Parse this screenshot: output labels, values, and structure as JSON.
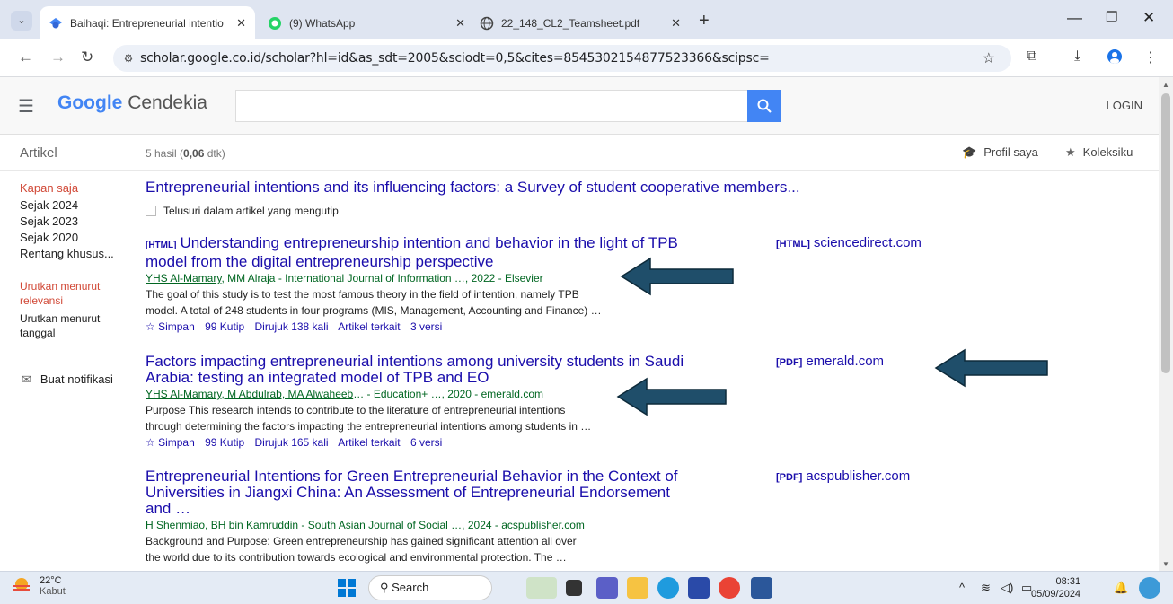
{
  "browser": {
    "tabs": [
      {
        "title": "Baihaqi: Entrepreneurial intentio",
        "close": "✕"
      },
      {
        "title": "(9) WhatsApp",
        "close": "✕"
      },
      {
        "title": "22_148_CL2_Teamsheet.pdf",
        "close": "✕"
      }
    ],
    "url": "scholar.google.co.id/scholar?hl=id&as_sdt=2005&sciodt=0,5&cites=8545302154877523366&scipsc="
  },
  "header": {
    "logo_google": "Google",
    "logo_cendekia": "Cendekia",
    "login": "LOGIN"
  },
  "subbar": {
    "section": "Artikel",
    "count_prefix": "5 hasil (",
    "count_time": "0,06",
    "count_suffix": " dtk)",
    "profile": "Profil saya",
    "collection": "Koleksiku"
  },
  "filters": {
    "time": [
      "Kapan saja",
      "Sejak 2024",
      "Sejak 2023",
      "Sejak 2020",
      "Rentang khusus..."
    ],
    "sort": [
      "Urutkan menurut relevansi",
      "Urutkan menurut tanggal"
    ],
    "alert": "Buat notifikasi"
  },
  "cited_work": {
    "title": "Entrepreneurial intentions and its influencing factors: a Survey of student cooperative members...",
    "search_within": "Telusuri dalam artikel yang mengutip"
  },
  "results": [
    {
      "tag": "[HTML]",
      "title_l1": "Understanding entrepreneurship intention and behavior in the light of TPB",
      "title_l2": "model from the digital entrepreneurship perspective",
      "authors_linked": "YHS Al-Mamary",
      "authors_rest": ", MM Alraja - International Journal of Information …, 2022 - Elsevier",
      "snippet_l1": "The goal of this study is to test the most famous theory in the field of intention, namely TPB",
      "snippet_l2": "model. A total of 248 students in four programs (MIS, Management, Accounting and Finance) …",
      "save": "☆ Simpan",
      "cite": "99 Kutip",
      "cited_by": "Dirujuk 138 kali",
      "related": "Artikel terkait",
      "versions": "3 versi",
      "side_tag": "[HTML]",
      "side_domain": "sciencedirect.com"
    },
    {
      "tag": "",
      "title_l1": "Factors impacting entrepreneurial intentions among university students in Saudi",
      "title_l2": "Arabia: testing an integrated model of TPB and EO",
      "authors_linked": "YHS Al-Mamary, M Abdulrab, MA Alwaheeb",
      "authors_rest": "… - Education+ …, 2020 - emerald.com",
      "snippet_l1": "Purpose This research intends to contribute to the literature of entrepreneurial intentions",
      "snippet_l2": "through determining the factors impacting the entrepreneurial intentions among students in …",
      "save": "☆ Simpan",
      "cite": "99 Kutip",
      "cited_by": "Dirujuk 165 kali",
      "related": "Artikel terkait",
      "versions": "6 versi",
      "side_tag": "[PDF]",
      "side_domain": "emerald.com"
    },
    {
      "tag": "",
      "title_l1": "Entrepreneurial Intentions for Green Entrepreneurial Behavior in the Context of",
      "title_l2": "Universities in Jiangxi China: An Assessment of Entrepreneurial Endorsement",
      "title_l3": "and …",
      "authors_rest": "H Shenmiao, BH bin Kamruddin - South Asian Journal of Social …, 2024 - acspublisher.com",
      "snippet_l1": "Background and Purpose: Green entrepreneurship has gained significant attention all over",
      "snippet_l2": "the world due to its contribution towards ecological and environmental protection. The …",
      "side_tag": "[PDF]",
      "side_domain": "acspublisher.com"
    }
  ],
  "taskbar": {
    "temp": "22°C",
    "weather": "Kabut",
    "search": "Search",
    "time": "08:31",
    "date": "05/09/2024"
  },
  "colors": {
    "link": "#1a0dab",
    "author_green": "#006621",
    "accent_red": "#d14836",
    "search_blue": "#4285f4",
    "arrow_fill": "#1f4e6a"
  }
}
